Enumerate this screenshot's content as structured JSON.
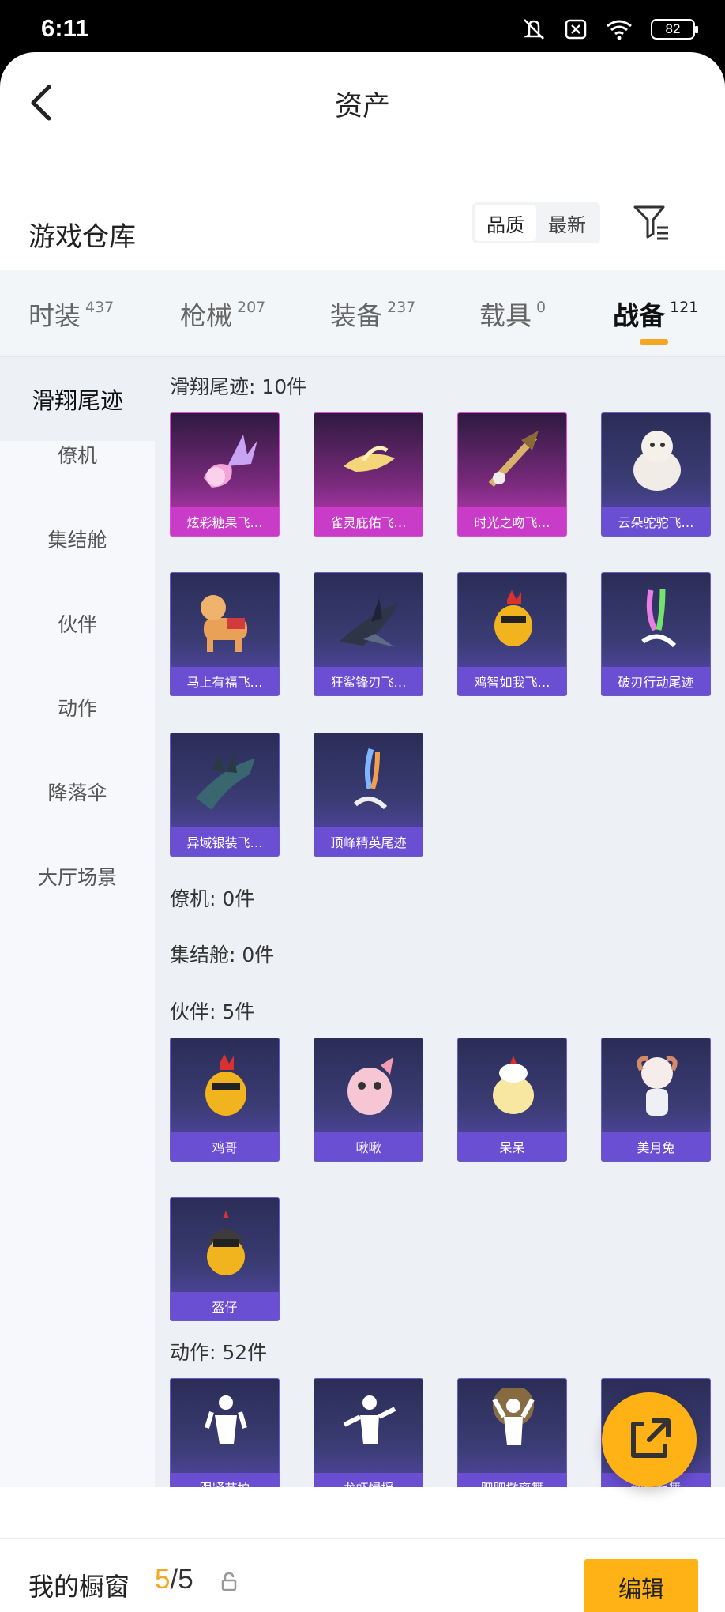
{
  "status": {
    "time": "6:11",
    "battery": "82"
  },
  "nav": {
    "title": "资产"
  },
  "warehouse": {
    "title": "游戏仓库",
    "sort_quality": "品质",
    "sort_newest": "最新"
  },
  "tabs": [
    {
      "label": "时装",
      "count": "437"
    },
    {
      "label": "枪械",
      "count": "207"
    },
    {
      "label": "装备",
      "count": "237"
    },
    {
      "label": "载具",
      "count": "0"
    },
    {
      "label": "战备",
      "count": "121",
      "active": true
    }
  ],
  "sidebar": [
    {
      "label": "滑翔尾迹",
      "active": true
    },
    {
      "label": "僚机"
    },
    {
      "label": "集结舱"
    },
    {
      "label": "伙伴"
    },
    {
      "label": "动作"
    },
    {
      "label": "降落伞"
    },
    {
      "label": "大厅场景"
    }
  ],
  "sections": {
    "glide": "滑翔尾迹: 10件",
    "wingman": "僚机: 0件",
    "rally": "集结舱: 0件",
    "partner": "伙伴: 5件",
    "emote": "动作: 52件"
  },
  "items": {
    "glide": [
      "炫彩糖果飞…",
      "雀灵庇佑飞…",
      "时光之吻飞…",
      "云朵驼驼飞…",
      "马上有福飞…",
      "狂鲨锋刃飞…",
      "鸡智如我飞…",
      "破刃行动尾迹",
      "异域银装飞…",
      "顶峰精英尾迹"
    ],
    "partner": [
      "鸡哥",
      "啾啾",
      "呆呆",
      "美月兔",
      "盔仔"
    ],
    "emote": [
      "跟紧节拍",
      "龙虾慢摇",
      "肥肥撒离舞",
      "玲珑起舞"
    ]
  },
  "bottom": {
    "label": "我的橱窗",
    "current": "5",
    "total": "/5",
    "edit": "编辑"
  },
  "colors": {
    "accent": "#ffb215",
    "card_purple": "#6a4fd2",
    "card_pink": "#c93cc8"
  }
}
